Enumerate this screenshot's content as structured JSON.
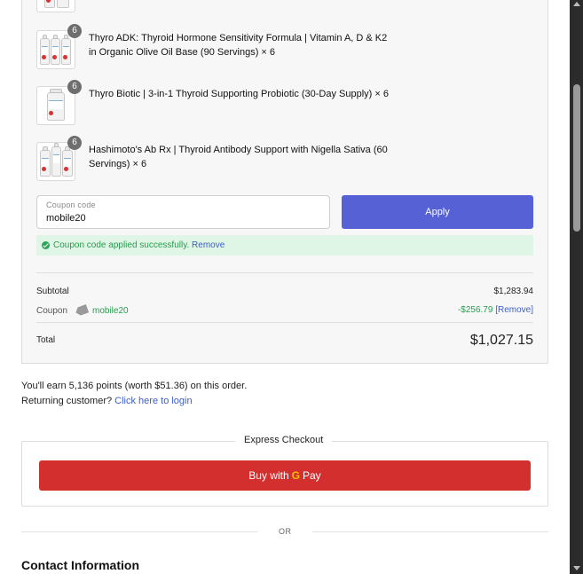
{
  "products": [
    {
      "name": "Thyro ADK: Thyroid Hormone Sensitivity Formula | Vitamin A, D & K2 in Organic Olive Oil Base (90 Servings) × 6",
      "qty": "6"
    },
    {
      "name": "Thyro Biotic | 3-in-1 Thyroid Supporting Probiotic (30-Day Supply) × 6",
      "qty": "6"
    },
    {
      "name": "Hashimoto's Ab Rx | Thyroid Antibody Support with Nigella Sativa (60 Servings) × 6",
      "qty": "6"
    }
  ],
  "coupon": {
    "placeholder": "Coupon code",
    "value": "mobile20",
    "apply_label": "Apply",
    "success_message": "Coupon code applied successfully.",
    "remove_label": "Remove"
  },
  "totals": {
    "subtotal_label": "Subtotal",
    "subtotal_value": "$1,283.94",
    "coupon_label": "Coupon",
    "coupon_code": "mobile20",
    "discount_value": "-$256.79",
    "discount_remove": "[Remove]",
    "total_label": "Total",
    "total_value": "$1,027.15"
  },
  "points": {
    "text": "You'll earn 5,136 points (worth $51.36) on this order."
  },
  "returning": {
    "prefix": "Returning customer?",
    "link": "Click here to login"
  },
  "express": {
    "title": "Express Checkout",
    "button_prefix": "Buy with",
    "button_brand_g": "G",
    "button_brand_pay": "Pay"
  },
  "divider_text": "OR",
  "contact_title": "Contact Information",
  "colors": {
    "apply_button": "#5661d6",
    "gpay_button": "#d32f2f",
    "success_green": "#2c9a50",
    "link_blue": "#3d5fc4"
  }
}
